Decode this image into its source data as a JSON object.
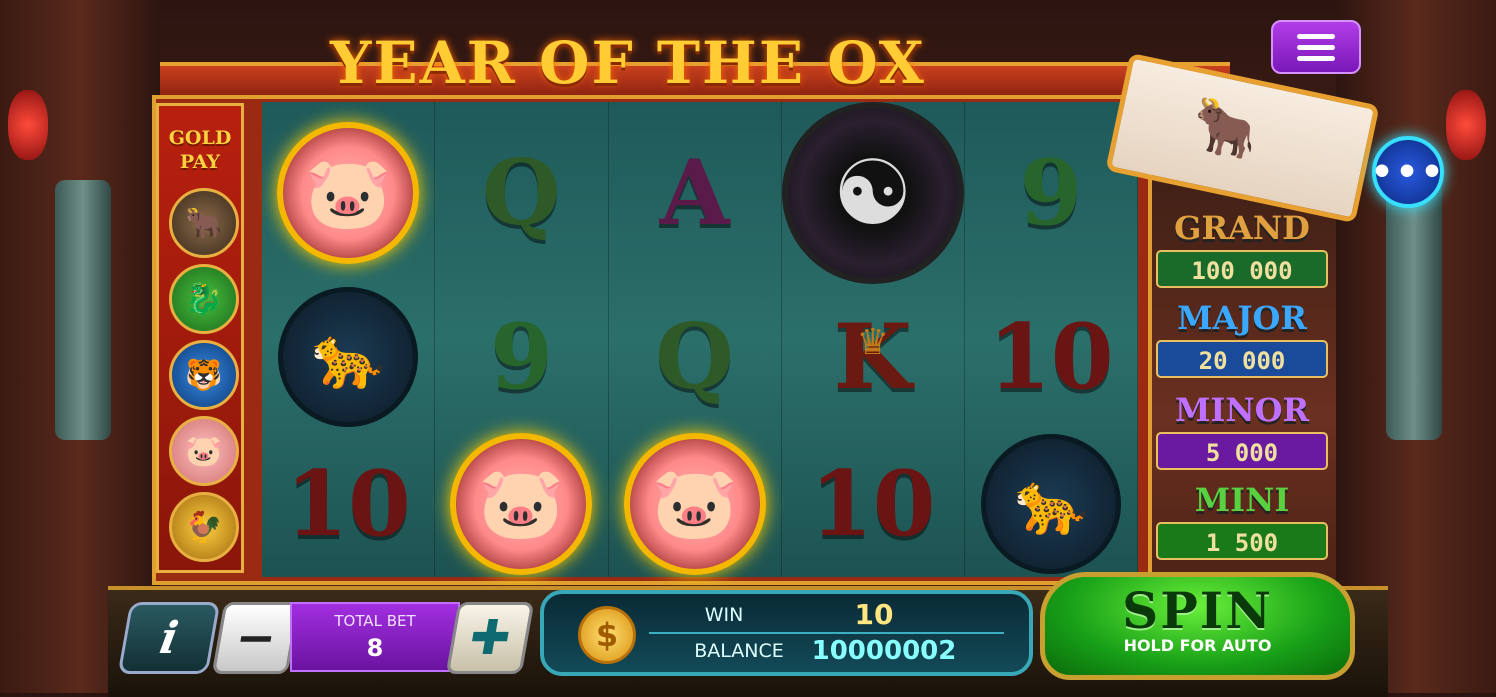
{
  "game": {
    "title": "YEAR OF THE OX"
  },
  "goldpay": {
    "label_line1": "GOLD",
    "label_line2": "PAY",
    "icons": [
      "ox-icon",
      "dragon-icon",
      "tiger-icon",
      "pig-icon",
      "rooster-icon"
    ]
  },
  "reels": [
    [
      "pig",
      "q",
      "a",
      "yinyang",
      "9"
    ],
    [
      "tiger",
      "9",
      "q",
      "k",
      "10"
    ],
    [
      "10",
      "pig",
      "pig",
      "10",
      "tiger"
    ]
  ],
  "symbols": {
    "q": "Q",
    "a": "A",
    "9": "9",
    "10": "10",
    "k": "K"
  },
  "jackpots": [
    {
      "name": "GRAND",
      "value": "100 000",
      "label_color": "#e0a040",
      "value_bg": "#1a6a2a"
    },
    {
      "name": "MAJOR",
      "value": "20 000",
      "label_color": "#3aa8ff",
      "value_bg": "#1a4a9a"
    },
    {
      "name": "MINOR",
      "value": "5 000",
      "label_color": "#c070ff",
      "value_bg": "#6a1aa0"
    },
    {
      "name": "MINI",
      "value": "1 500",
      "label_color": "#58d040",
      "value_bg": "#1a7a1a"
    }
  ],
  "controls": {
    "info_label": "i",
    "minus_label": "−",
    "plus_label": "✚",
    "total_bet_label": "TOTAL BET",
    "total_bet": "8",
    "win_label": "WIN",
    "win": "10",
    "balance_label": "BALANCE",
    "balance": "10000002",
    "coin_symbol": "$",
    "spin_label": "SPIN",
    "spin_sub": "HOLD FOR AUTO",
    "more_label": "•••"
  }
}
